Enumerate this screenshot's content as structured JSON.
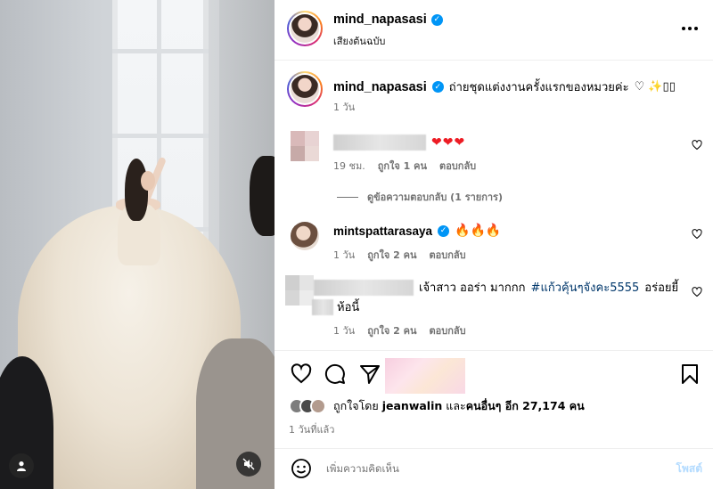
{
  "post": {
    "username": "mind_napasasi",
    "audio_label": "เสียงต้นฉบับ",
    "caption_text": "ถ่ายชุดแต่งงานครั้งแรกของหมวยค่ะ",
    "caption_emoji": "♡ ✨▯▯",
    "caption_time": "1 วัน"
  },
  "comments": [
    {
      "username_hidden": true,
      "text": "❤❤❤",
      "time": "19 ชม.",
      "likes": "ถูกใจ 1 คน",
      "reply": "ตอบกลับ"
    },
    {
      "username": "mintspattarasaya",
      "text": "🔥🔥🔥",
      "time": "1 วัน",
      "likes": "ถูกใจ 2 คน",
      "reply": "ตอบกลับ"
    },
    {
      "username_hidden": true,
      "text_part1": "เจ้าสาว ออร่า มากกก",
      "hashtag": "#แก้วคุ้นๆจังคะ5555",
      "text_part2": "อร่อยยี้",
      "text_line2": "ห้อนี้",
      "time": "1 วัน",
      "likes": "ถูกใจ 2 คน",
      "reply": "ตอบกลับ"
    }
  ],
  "view_replies": "ดูข้อความตอบกลับ (1 รายการ)",
  "likes_summary": {
    "prefix": "ถูกใจโดย",
    "user": "jeanwalin",
    "middle": "และ",
    "others": "คนอื่นๆ อีก 27,174 คน"
  },
  "post_date": "1 วันที่แล้ว",
  "add_comment": {
    "placeholder": "เพิ่มความคิดเห็น",
    "post_label": "โพสต์"
  },
  "icons": {
    "like": "heart-icon",
    "comment": "comment-icon",
    "share": "send-icon",
    "save": "bookmark-icon",
    "more": "more-icon",
    "mute": "mute-icon",
    "user_tag": "user-icon",
    "emoji": "emoji-icon",
    "verified": "verified-icon"
  },
  "colors": {
    "verified": "#0095f6",
    "link": "#00376b",
    "muted_text": "#737373",
    "post_button_disabled": "#b3dbff",
    "heart_red": "#ed1c24"
  }
}
